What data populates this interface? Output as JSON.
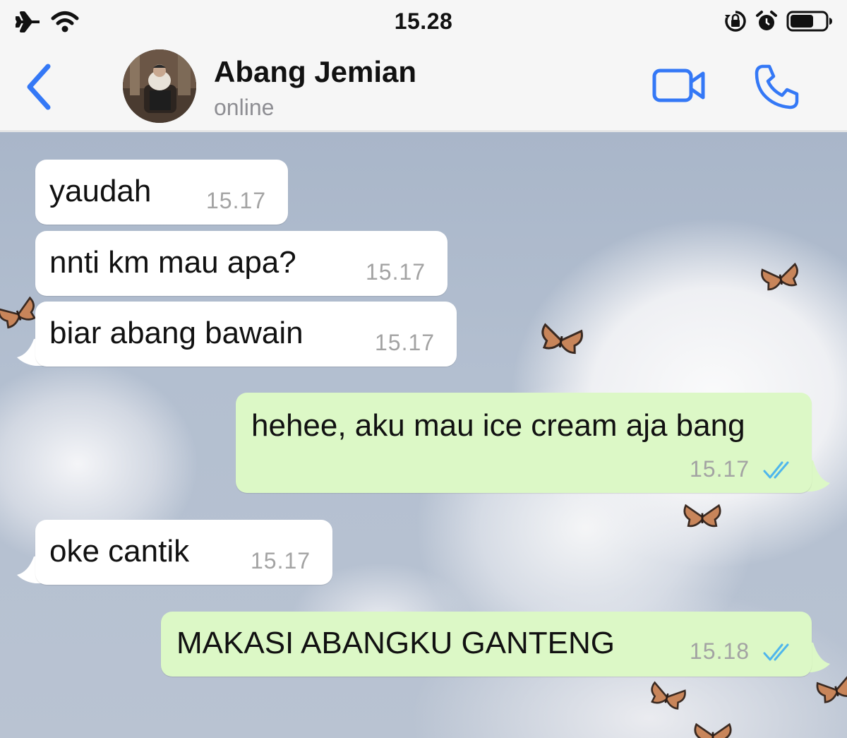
{
  "status_bar": {
    "time": "15.28",
    "icons": [
      "airplane-icon",
      "wifi-icon",
      "orientation-lock-icon",
      "alarm-icon",
      "battery-icon"
    ]
  },
  "header": {
    "back_icon": "chevron-left-icon",
    "contact_name": "Abang Jemian",
    "contact_status": "online",
    "video_icon": "video-camera-icon",
    "call_icon": "phone-icon",
    "accent_color": "#3478f6"
  },
  "messages": [
    {
      "direction": "incoming",
      "text": "yaudah",
      "time": "15.17"
    },
    {
      "direction": "incoming",
      "text": "nnti km mau apa?",
      "time": "15.17"
    },
    {
      "direction": "incoming",
      "text": "biar abang bawain",
      "time": "15.17"
    },
    {
      "direction": "outgoing",
      "text": "hehee, aku mau ice cream aja bang",
      "time": "15.17",
      "status": "read"
    },
    {
      "direction": "incoming",
      "text": "oke cantik",
      "time": "15.17"
    },
    {
      "direction": "outgoing",
      "text": "MAKASI ABANGKU GANTENG",
      "time": "15.18",
      "status": "read"
    }
  ],
  "colors": {
    "incoming_bubble": "#ffffff",
    "outgoing_bubble": "#dcf8c6",
    "read_ticks": "#4fb6ec",
    "timestamp": "#a3a3a3"
  }
}
